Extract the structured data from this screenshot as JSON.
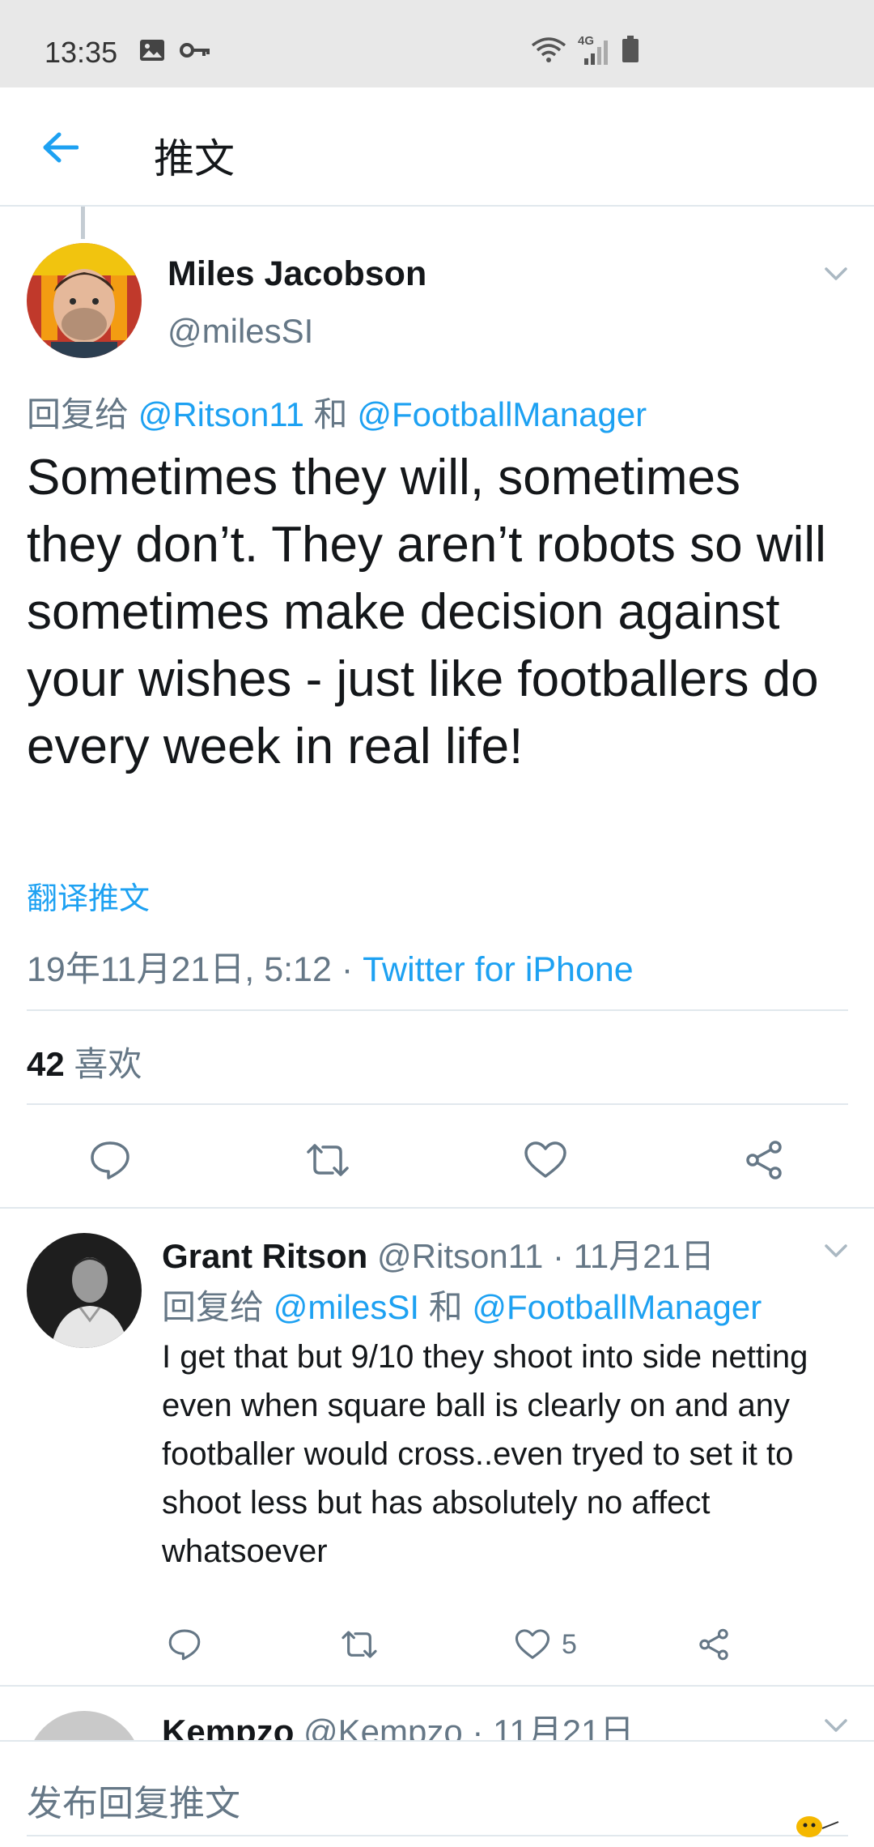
{
  "status_bar": {
    "time": "13:35",
    "icons_left": [
      "image-icon",
      "key-icon"
    ],
    "icons_right": [
      "wifi-icon",
      "signal-4g-icon",
      "battery-icon"
    ],
    "network_label": "4G"
  },
  "header": {
    "title": "推文",
    "back_icon": "arrow-left-icon"
  },
  "main_tweet": {
    "name": "Miles Jacobson",
    "handle": "@milesSI",
    "reply_prefix": "回复给",
    "reply_user1": "@Ritson11",
    "reply_and": "和",
    "reply_user2": "@FootballManager",
    "text": "Sometimes they will, sometimes they don’t. They aren’t robots so will sometimes make decision against your wishes - just like footballers do every week in real life!",
    "translate": "翻译推文",
    "timestamp": "19年11月21日, 5:12",
    "meta_separator": "·",
    "source": "Twitter for iPhone",
    "likes_count": "42",
    "likes_label": "喜欢"
  },
  "reply": {
    "name": "Grant Ritson",
    "handle": "@Ritson11",
    "separator": "·",
    "date": "11月21日",
    "reply_prefix": "回复给",
    "reply_user1": "@milesSI",
    "reply_and": "和",
    "reply_user2": "@FootballManager",
    "text": "I get that but 9/10 they shoot into side netting even when square ball is clearly on and any footballer would cross..even tryed to set it to shoot less but has absolutely no affect whatsoever",
    "like_count": "5"
  },
  "next_reply": {
    "name": "Kempzo",
    "handle": "@Kempzo",
    "separator": "·",
    "date": "11月21日"
  },
  "compose": {
    "placeholder": "发布回复推文"
  },
  "colors": {
    "accent": "#1da1f2",
    "text": "#14171a",
    "secondary": "#657786",
    "divider": "#e1e8ed",
    "status_bar_bg": "#e8e8e8"
  }
}
